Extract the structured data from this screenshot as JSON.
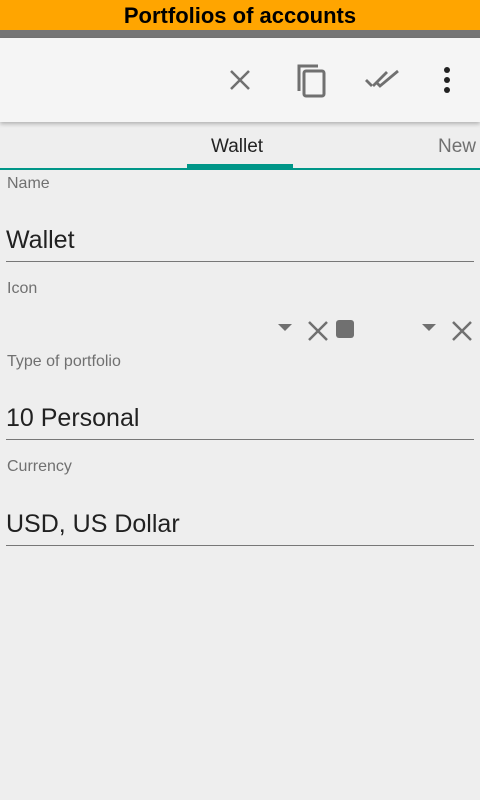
{
  "banner": {
    "title": "Portfolios of accounts"
  },
  "toolbar": {
    "icons": [
      "close-icon",
      "copy-icon",
      "done-all-icon",
      "more-vert-icon"
    ]
  },
  "tabs": [
    {
      "label": "Wallet",
      "active": true
    },
    {
      "label": "New",
      "active": false
    }
  ],
  "form": {
    "name": {
      "label": "Name",
      "value": "Wallet"
    },
    "icon": {
      "label": "Icon"
    },
    "type": {
      "label": "Type of portfolio",
      "value": "10 Personal"
    },
    "currency": {
      "label": "Currency",
      "value": "USD, US Dollar"
    }
  },
  "colors": {
    "banner": "#ffa500",
    "accent": "#009688"
  }
}
